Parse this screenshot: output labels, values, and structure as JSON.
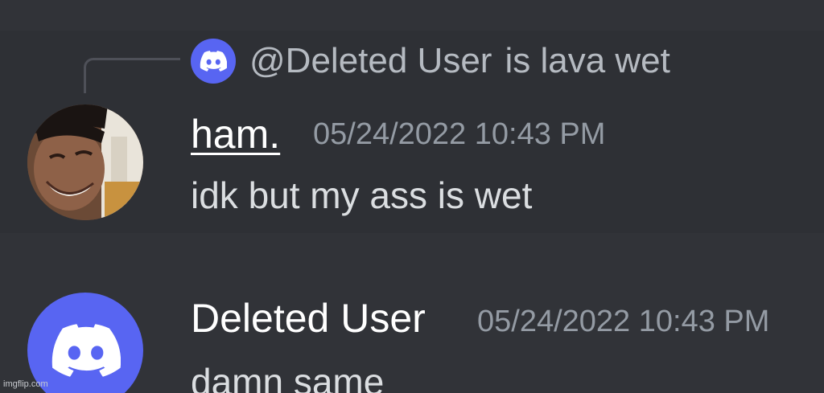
{
  "reply": {
    "avatar_icon": "discord-logo-icon",
    "mention": "@Deleted User",
    "text": "is lava wet"
  },
  "messages": [
    {
      "author": "ham.",
      "timestamp": "05/24/2022 10:43 PM",
      "content": "idk but my ass is wet",
      "avatar": "profile-photo"
    },
    {
      "author": "Deleted User",
      "timestamp": "05/24/2022 10:43 PM",
      "content": "damn same",
      "avatar_icon": "discord-logo-icon"
    }
  ],
  "watermark": "imgflip.com",
  "colors": {
    "background": "#313338",
    "highlight": "#2e3035",
    "blurple": "#5865f2",
    "text": "#dbdee1",
    "muted": "#949ba4"
  }
}
